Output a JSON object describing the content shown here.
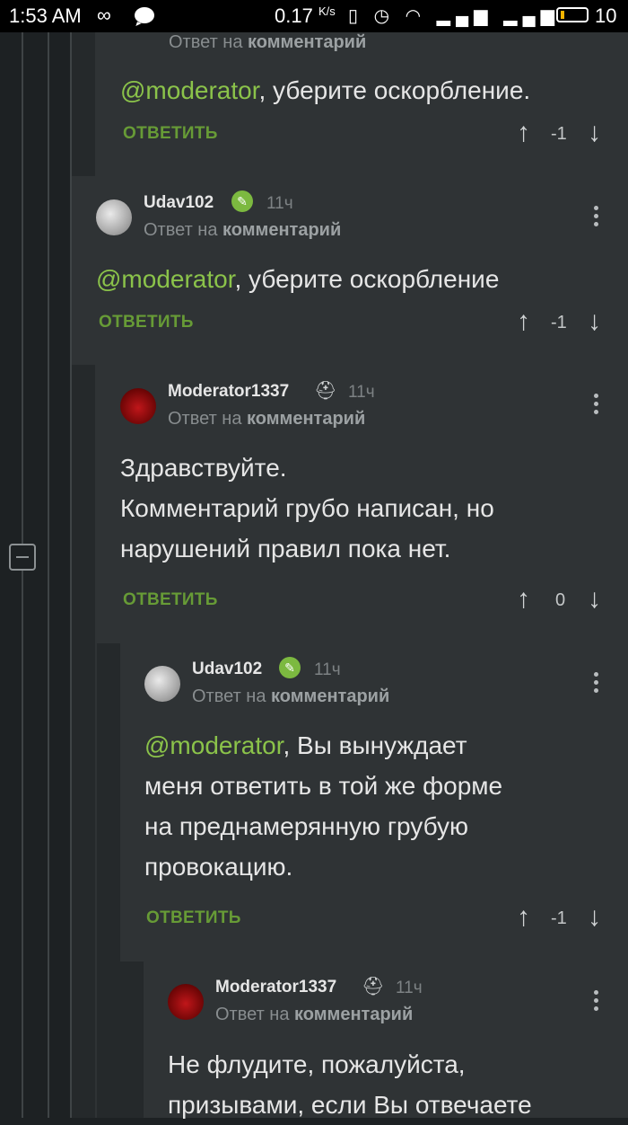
{
  "status_bar": {
    "time": "1:53 AM",
    "speed": "0.17",
    "speed_unit": "K/s",
    "battery": "10"
  },
  "comments": [
    {
      "mention": "@moderator",
      "text": ", уберите оскорбление.",
      "reply_prefix": "Ответ на",
      "reply_target": "комментарий",
      "reply_button": "ОТВЕТИТЬ",
      "rating": "-1"
    },
    {
      "author": "Udav102",
      "time": "11ч",
      "reply_prefix": "Ответ на",
      "reply_target": "комментарий",
      "mention": "@moderator",
      "text": ", уберите оскорбление",
      "reply_button": "ОТВЕТИТЬ",
      "rating": "-1"
    },
    {
      "author": "Moderator1337",
      "time": "11ч",
      "reply_prefix": "Ответ на",
      "reply_target": "комментарий",
      "lines": [
        "Здравствуйте.",
        "Комментарий грубо написан, но",
        "нарушений правил пока нет."
      ],
      "reply_button": "ОТВЕТИТЬ",
      "rating": "0"
    },
    {
      "author": "Udav102",
      "time": "11ч",
      "reply_prefix": "Ответ на",
      "reply_target": "комментарий",
      "mention": "@moderator",
      "line1_rest": ", Вы вынуждает",
      "lines": [
        "меня ответить в той же форме",
        "на преднамерянную грубую",
        "провокацию."
      ],
      "reply_button": "ОТВЕТИТЬ",
      "rating": "-1"
    },
    {
      "author": "Moderator1337",
      "time": "11ч",
      "reply_prefix": "Ответ на",
      "reply_target": "комментарий",
      "lines": [
        "Не флудите, пожалуйста,",
        "призывами, если Вы отвечаете"
      ]
    }
  ]
}
